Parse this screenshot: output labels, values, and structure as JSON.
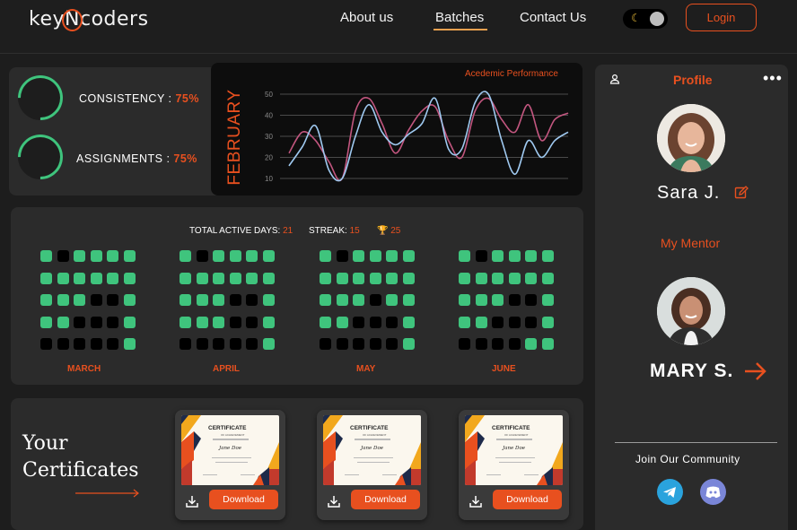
{
  "header": {
    "logo_pre": "key",
    "logo_n": "N",
    "logo_post": "coders",
    "nav": [
      "About us",
      "Batches",
      "Contact Us"
    ],
    "login_label": "Login"
  },
  "stats": {
    "consistency_label": "CONSISTENCY : ",
    "consistency_value": "75%",
    "assignments_label": "ASSIGNMENTS : ",
    "assignments_value": "75%"
  },
  "performance": {
    "month": "FEBRUARY",
    "title": "Acedemic Performance"
  },
  "chart_data": {
    "type": "line",
    "title": "Acedemic Performance",
    "y_ticks": [
      50,
      40,
      30,
      20,
      10
    ],
    "ylim": [
      10,
      50
    ],
    "grid": true,
    "series": [
      {
        "color": "#c2567f",
        "values": [
          22,
          32,
          28,
          18,
          10,
          42,
          48,
          36,
          22,
          33,
          42,
          44,
          28,
          20,
          42,
          48,
          38,
          32,
          45,
          28,
          38,
          41
        ]
      },
      {
        "color": "#9fc9f0",
        "values": [
          16,
          25,
          35,
          14,
          10,
          30,
          45,
          32,
          26,
          31,
          36,
          48,
          24,
          24,
          46,
          50,
          28,
          12,
          28,
          20,
          28,
          32
        ]
      }
    ]
  },
  "activity": {
    "total_label": "TOTAL ACTIVE DAYS: ",
    "total_value": "21",
    "streak_label": "STREAK: ",
    "streak_value": "15",
    "trophy_value": "25",
    "months": [
      {
        "name": "MARCH",
        "cells": [
          1,
          0,
          1,
          1,
          1,
          1,
          1,
          1,
          1,
          1,
          1,
          1,
          1,
          1,
          1,
          0,
          0,
          1,
          1,
          1,
          0,
          0,
          0,
          1,
          0,
          0,
          0,
          0,
          0,
          1
        ]
      },
      {
        "name": "APRIL",
        "cells": [
          1,
          0,
          1,
          1,
          1,
          1,
          1,
          1,
          1,
          1,
          1,
          1,
          1,
          1,
          1,
          0,
          0,
          1,
          1,
          1,
          1,
          0,
          0,
          1,
          0,
          0,
          0,
          0,
          0,
          1
        ]
      },
      {
        "name": "MAY",
        "cells": [
          1,
          0,
          1,
          1,
          1,
          1,
          1,
          1,
          1,
          1,
          1,
          1,
          1,
          1,
          1,
          0,
          1,
          1,
          1,
          1,
          0,
          0,
          0,
          1,
          0,
          0,
          0,
          0,
          0,
          1
        ]
      },
      {
        "name": "JUNE",
        "cells": [
          1,
          0,
          1,
          1,
          1,
          1,
          1,
          1,
          1,
          1,
          1,
          1,
          1,
          1,
          1,
          0,
          0,
          1,
          1,
          1,
          0,
          0,
          0,
          1,
          0,
          0,
          0,
          0,
          1,
          1
        ]
      }
    ]
  },
  "certificates": {
    "title_line1": "Your",
    "title_line2": "Certificates",
    "cert_heading": "CERTIFICATE",
    "cert_sub": "OF ACHIEVEMENT",
    "cert_name": "Jane Doe",
    "download_label": "Download"
  },
  "profile": {
    "title": "Profile",
    "name": "Sara J.",
    "mentor_title": "My Mentor",
    "mentor_name": "MARY S.",
    "community_label": "Join Our Community"
  },
  "colors": {
    "accent": "#e8501f",
    "green": "#3fc47d",
    "card": "#2b2b2b"
  }
}
